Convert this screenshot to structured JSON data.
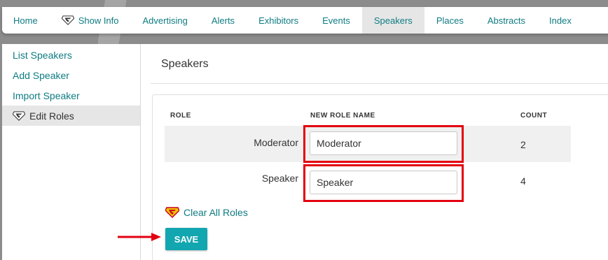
{
  "nav": {
    "items": [
      {
        "label": "Home",
        "icon": ""
      },
      {
        "label": "Show Info",
        "icon": "superman-shield-icon"
      },
      {
        "label": "Advertising",
        "icon": ""
      },
      {
        "label": "Alerts",
        "icon": ""
      },
      {
        "label": "Exhibitors",
        "icon": ""
      },
      {
        "label": "Events",
        "icon": ""
      },
      {
        "label": "Speakers",
        "icon": "",
        "active": true
      },
      {
        "label": "Places",
        "icon": ""
      },
      {
        "label": "Abstracts",
        "icon": ""
      },
      {
        "label": "Index",
        "icon": ""
      }
    ]
  },
  "sidebar": {
    "items": [
      {
        "label": "List Speakers"
      },
      {
        "label": "Add Speaker"
      },
      {
        "label": "Import Speaker"
      },
      {
        "label": "Edit Roles",
        "icon": "superman-shield-icon",
        "active": true
      }
    ]
  },
  "main": {
    "title": "Speakers",
    "table": {
      "headers": {
        "role": "ROLE",
        "new_name": "NEW ROLE NAME",
        "count": "COUNT"
      },
      "rows": [
        {
          "role": "Moderator",
          "new_name": "Moderator",
          "count": "2"
        },
        {
          "role": "Speaker",
          "new_name": "Speaker",
          "count": "4"
        }
      ]
    },
    "clear_label": "Clear All Roles",
    "save_label": "SAVE"
  },
  "colors": {
    "accent": "#12a6b0",
    "link": "#0f7c82",
    "highlight": "#e3000f"
  }
}
